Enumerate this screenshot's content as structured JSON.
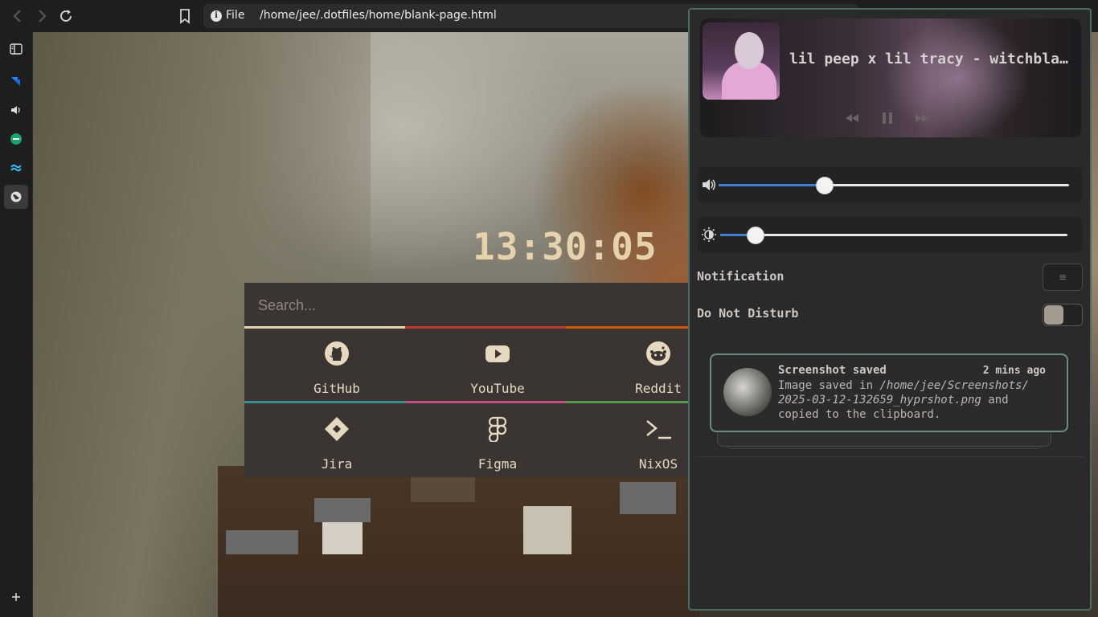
{
  "browser": {
    "url_scheme": "File",
    "url_path": "/home/jee/.dotfiles/home/blank-page.html",
    "nav": {
      "back": "back-icon",
      "forward": "forward-icon",
      "reload": "reload-icon",
      "bookmark": "bookmark-icon"
    }
  },
  "sidebar": {
    "items": [
      {
        "name": "sidebar-toggle",
        "icon": "sidebar-panel-icon"
      },
      {
        "name": "jira-app",
        "icon": "jira-icon"
      },
      {
        "name": "audio-app",
        "icon": "speaker-icon"
      },
      {
        "name": "green-app",
        "icon": "green-circle-icon"
      },
      {
        "name": "tailwind-app",
        "icon": "tailwind-icon"
      },
      {
        "name": "globe-app",
        "icon": "globe-icon",
        "active": true
      }
    ],
    "add_icon": "plus-icon"
  },
  "startpage": {
    "clock": "13:30:05",
    "search_placeholder": "Search...",
    "links": [
      {
        "label": "GitHub",
        "icon": "github-icon"
      },
      {
        "label": "YouTube",
        "icon": "youtube-icon"
      },
      {
        "label": "Reddit",
        "icon": "reddit-icon"
      },
      {
        "label": "Jira",
        "icon": "jira-diamond-icon"
      },
      {
        "label": "Figma",
        "icon": "figma-icon"
      },
      {
        "label": "NixOS",
        "icon": "terminal-icon"
      }
    ],
    "accent_colors": [
      "#e6d2ac",
      "#c0392b",
      "#d35400",
      "#3d8c8c",
      "#c05080",
      "#5a9a50"
    ]
  },
  "control_center": {
    "media": {
      "track": "lil peep x lil tracy - witchblades",
      "prev_icon": "rewind-icon",
      "play_icon": "pause-icon",
      "next_icon": "fast-forward-icon"
    },
    "volume": {
      "icon": "volume-icon",
      "level": 0.3
    },
    "brightness": {
      "icon": "brightness-icon",
      "level": 0.1
    },
    "notification_label": "Notification",
    "notification_button": "≡",
    "dnd_label": "Do Not Disturb",
    "dnd_enabled": false,
    "toast": {
      "title": "Screenshot saved",
      "time": "2 mins ago",
      "body_prefix": "Image saved in ",
      "body_path": "/home/jee/Screenshots/ 2025-03-12-132659_hyprshot.png",
      "body_suffix": " and copied to the clipboard."
    }
  }
}
